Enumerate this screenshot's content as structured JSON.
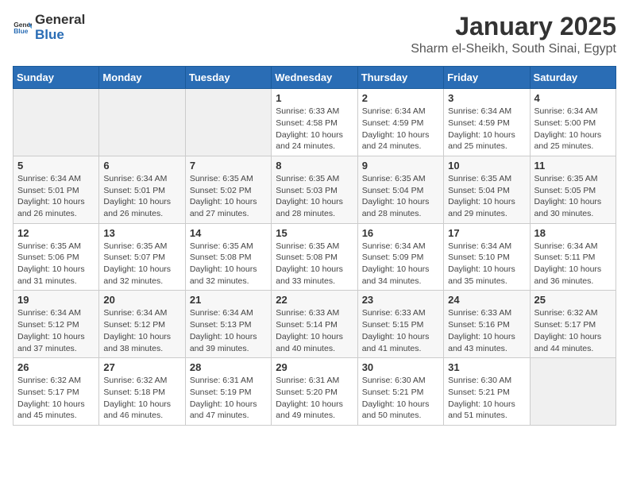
{
  "header": {
    "logo_general": "General",
    "logo_blue": "Blue",
    "month_title": "January 2025",
    "location": "Sharm el-Sheikh, South Sinai, Egypt"
  },
  "calendar": {
    "days_of_week": [
      "Sunday",
      "Monday",
      "Tuesday",
      "Wednesday",
      "Thursday",
      "Friday",
      "Saturday"
    ],
    "weeks": [
      [
        {
          "day": "",
          "info": ""
        },
        {
          "day": "",
          "info": ""
        },
        {
          "day": "",
          "info": ""
        },
        {
          "day": "1",
          "info": "Sunrise: 6:33 AM\nSunset: 4:58 PM\nDaylight: 10 hours and 24 minutes."
        },
        {
          "day": "2",
          "info": "Sunrise: 6:34 AM\nSunset: 4:59 PM\nDaylight: 10 hours and 24 minutes."
        },
        {
          "day": "3",
          "info": "Sunrise: 6:34 AM\nSunset: 4:59 PM\nDaylight: 10 hours and 25 minutes."
        },
        {
          "day": "4",
          "info": "Sunrise: 6:34 AM\nSunset: 5:00 PM\nDaylight: 10 hours and 25 minutes."
        }
      ],
      [
        {
          "day": "5",
          "info": "Sunrise: 6:34 AM\nSunset: 5:01 PM\nDaylight: 10 hours and 26 minutes."
        },
        {
          "day": "6",
          "info": "Sunrise: 6:34 AM\nSunset: 5:01 PM\nDaylight: 10 hours and 26 minutes."
        },
        {
          "day": "7",
          "info": "Sunrise: 6:35 AM\nSunset: 5:02 PM\nDaylight: 10 hours and 27 minutes."
        },
        {
          "day": "8",
          "info": "Sunrise: 6:35 AM\nSunset: 5:03 PM\nDaylight: 10 hours and 28 minutes."
        },
        {
          "day": "9",
          "info": "Sunrise: 6:35 AM\nSunset: 5:04 PM\nDaylight: 10 hours and 28 minutes."
        },
        {
          "day": "10",
          "info": "Sunrise: 6:35 AM\nSunset: 5:04 PM\nDaylight: 10 hours and 29 minutes."
        },
        {
          "day": "11",
          "info": "Sunrise: 6:35 AM\nSunset: 5:05 PM\nDaylight: 10 hours and 30 minutes."
        }
      ],
      [
        {
          "day": "12",
          "info": "Sunrise: 6:35 AM\nSunset: 5:06 PM\nDaylight: 10 hours and 31 minutes."
        },
        {
          "day": "13",
          "info": "Sunrise: 6:35 AM\nSunset: 5:07 PM\nDaylight: 10 hours and 32 minutes."
        },
        {
          "day": "14",
          "info": "Sunrise: 6:35 AM\nSunset: 5:08 PM\nDaylight: 10 hours and 32 minutes."
        },
        {
          "day": "15",
          "info": "Sunrise: 6:35 AM\nSunset: 5:08 PM\nDaylight: 10 hours and 33 minutes."
        },
        {
          "day": "16",
          "info": "Sunrise: 6:34 AM\nSunset: 5:09 PM\nDaylight: 10 hours and 34 minutes."
        },
        {
          "day": "17",
          "info": "Sunrise: 6:34 AM\nSunset: 5:10 PM\nDaylight: 10 hours and 35 minutes."
        },
        {
          "day": "18",
          "info": "Sunrise: 6:34 AM\nSunset: 5:11 PM\nDaylight: 10 hours and 36 minutes."
        }
      ],
      [
        {
          "day": "19",
          "info": "Sunrise: 6:34 AM\nSunset: 5:12 PM\nDaylight: 10 hours and 37 minutes."
        },
        {
          "day": "20",
          "info": "Sunrise: 6:34 AM\nSunset: 5:12 PM\nDaylight: 10 hours and 38 minutes."
        },
        {
          "day": "21",
          "info": "Sunrise: 6:34 AM\nSunset: 5:13 PM\nDaylight: 10 hours and 39 minutes."
        },
        {
          "day": "22",
          "info": "Sunrise: 6:33 AM\nSunset: 5:14 PM\nDaylight: 10 hours and 40 minutes."
        },
        {
          "day": "23",
          "info": "Sunrise: 6:33 AM\nSunset: 5:15 PM\nDaylight: 10 hours and 41 minutes."
        },
        {
          "day": "24",
          "info": "Sunrise: 6:33 AM\nSunset: 5:16 PM\nDaylight: 10 hours and 43 minutes."
        },
        {
          "day": "25",
          "info": "Sunrise: 6:32 AM\nSunset: 5:17 PM\nDaylight: 10 hours and 44 minutes."
        }
      ],
      [
        {
          "day": "26",
          "info": "Sunrise: 6:32 AM\nSunset: 5:17 PM\nDaylight: 10 hours and 45 minutes."
        },
        {
          "day": "27",
          "info": "Sunrise: 6:32 AM\nSunset: 5:18 PM\nDaylight: 10 hours and 46 minutes."
        },
        {
          "day": "28",
          "info": "Sunrise: 6:31 AM\nSunset: 5:19 PM\nDaylight: 10 hours and 47 minutes."
        },
        {
          "day": "29",
          "info": "Sunrise: 6:31 AM\nSunset: 5:20 PM\nDaylight: 10 hours and 49 minutes."
        },
        {
          "day": "30",
          "info": "Sunrise: 6:30 AM\nSunset: 5:21 PM\nDaylight: 10 hours and 50 minutes."
        },
        {
          "day": "31",
          "info": "Sunrise: 6:30 AM\nSunset: 5:21 PM\nDaylight: 10 hours and 51 minutes."
        },
        {
          "day": "",
          "info": ""
        }
      ]
    ]
  }
}
